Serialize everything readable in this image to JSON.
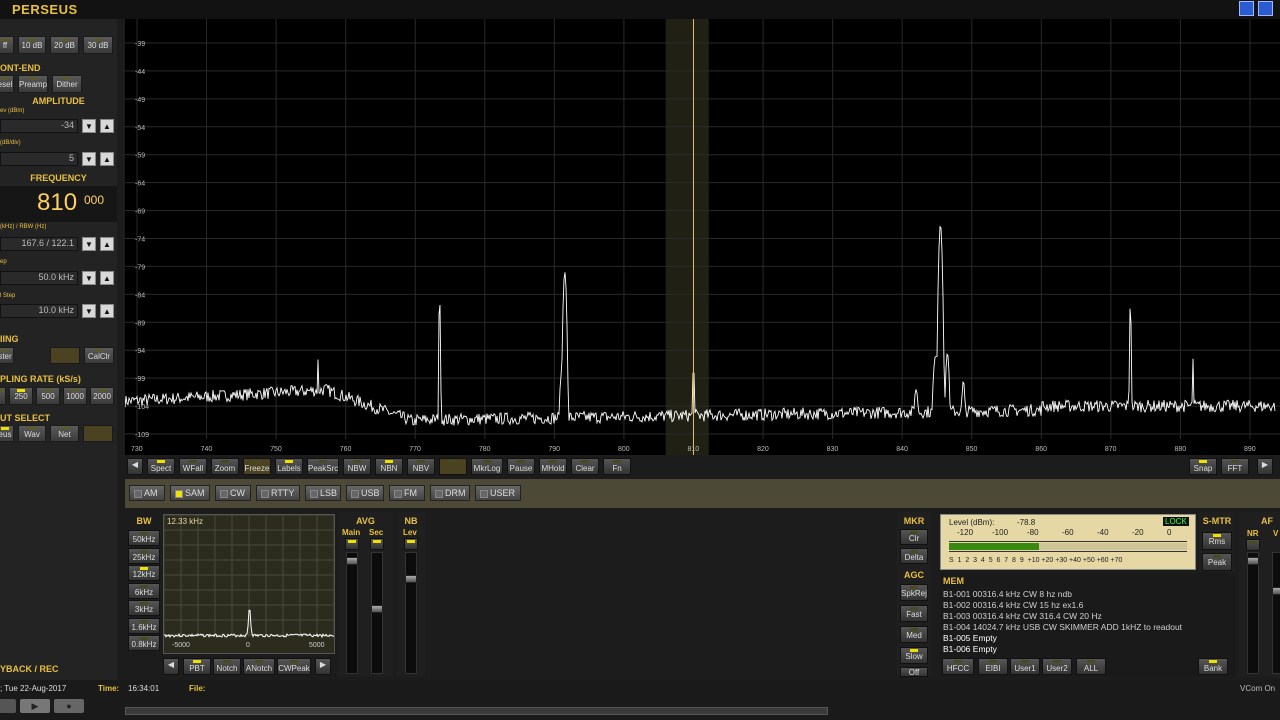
{
  "app": {
    "title": "PERSEUS"
  },
  "left": {
    "atten_buttons": [
      "ff",
      "10 dB",
      "20 dB",
      "30 dB"
    ],
    "frontend": {
      "title": "ONT-END",
      "buttons": [
        "esel",
        "Preamp",
        "Dither"
      ]
    },
    "amplitude": {
      "title": "AMPLITUDE",
      "ref_label": "ev (dBm)",
      "ref_value": "-34",
      "scale_label": "(dB/div)",
      "scale_value": "5"
    },
    "frequency": {
      "title": "FREQUENCY",
      "value_main": "810",
      "value_frac": "000",
      "span_label": "(kHz) / RBW (Hz)",
      "span_value": "167.6 / 122.1",
      "step_label": "ep",
      "step_value": "50.0 kHz",
      "fine_label": "l Step",
      "fine_value": "10.0 kHz"
    },
    "timing": {
      "title": "IING",
      "buttons": [
        "ster",
        "",
        "CalClr"
      ]
    },
    "sampling": {
      "title": "PLING RATE (kS/s)",
      "rates": [
        "",
        "250",
        "500",
        "1000",
        "2000"
      ]
    },
    "input": {
      "title": "UT SELECT",
      "buttons": [
        "eus",
        "Wav",
        "Net",
        ""
      ]
    },
    "playback": {
      "title": "YBACK / REC"
    }
  },
  "spectrum": {
    "y_ticks": [
      "-39",
      "-44",
      "-49",
      "-54",
      "-59",
      "-64",
      "-69",
      "-74",
      "-79",
      "-84",
      "-89",
      "-94",
      "-99",
      "-104",
      "-109"
    ],
    "x_ticks": [
      "730",
      "740",
      "750",
      "760",
      "770",
      "780",
      "790",
      "800",
      "810",
      "820",
      "830",
      "840",
      "850",
      "860",
      "870",
      "880",
      "890"
    ],
    "center_khz": 810,
    "colors": {
      "trace": "#ffffff",
      "grid": "#2a2a2a",
      "marker": "#e8c040",
      "passband": "#3a3a26"
    }
  },
  "toolbar": {
    "left": [
      {
        "label": "Spect",
        "on": true
      },
      {
        "label": "WFall",
        "on": false
      },
      {
        "label": "Zoom",
        "on": false
      },
      {
        "label": "Freeze",
        "on": false
      },
      {
        "label": "Labels",
        "on": true
      },
      {
        "label": "PeakSrc",
        "on": false
      },
      {
        "label": "NBW",
        "on": false
      },
      {
        "label": "NBN",
        "on": true
      },
      {
        "label": "NBV",
        "on": false
      },
      {
        "label": "",
        "on": false
      },
      {
        "label": "MkrLog",
        "on": false
      },
      {
        "label": "Pause",
        "on": false
      },
      {
        "label": "MHold",
        "on": false
      },
      {
        "label": "Clear",
        "on": false
      },
      {
        "label": "Fn",
        "on": false
      }
    ],
    "right": [
      {
        "label": "Snap",
        "on": true
      },
      {
        "label": "FFT",
        "on": false
      }
    ]
  },
  "modes": [
    {
      "label": "AM",
      "on": false
    },
    {
      "label": "SAM",
      "on": true
    },
    {
      "label": "CW",
      "on": false
    },
    {
      "label": "RTTY",
      "on": false
    },
    {
      "label": "LSB",
      "on": false
    },
    {
      "label": "USB",
      "on": false
    },
    {
      "label": "FM",
      "on": false
    },
    {
      "label": "DRM",
      "on": false
    },
    {
      "label": "USER",
      "on": false
    }
  ],
  "bw": {
    "title": "BW",
    "buttons": [
      {
        "label": "50kHz",
        "on": false
      },
      {
        "label": "25kHz",
        "on": false
      },
      {
        "label": "12kHz",
        "on": true
      },
      {
        "label": "6kHz",
        "on": false
      },
      {
        "label": "3kHz",
        "on": false
      },
      {
        "label": "1.6kHz",
        "on": false
      },
      {
        "label": "0.8kHz",
        "on": false
      }
    ],
    "display_value": "12.33 kHz",
    "axis": [
      "-5000",
      "0",
      "5000"
    ]
  },
  "filter_buttons": [
    {
      "label": "PBT",
      "on": true
    },
    {
      "label": "Notch",
      "on": false
    },
    {
      "label": "ANotch",
      "on": false
    },
    {
      "label": "CWPeak",
      "on": false
    }
  ],
  "avg": {
    "title": "AVG",
    "main": "Main",
    "sec": "Sec"
  },
  "nb": {
    "title": "NB",
    "lev": "Lev"
  },
  "mkr": {
    "title": "MKR",
    "buttons": [
      "Clr",
      "Delta"
    ]
  },
  "agc": {
    "title": "AGC",
    "buttons": [
      "SpkRej",
      "Fast",
      "Med",
      "Slow",
      "Off"
    ]
  },
  "smeter": {
    "level_label": "Level (dBm):",
    "level_value": "-78.8",
    "lock": "LOCK",
    "dbm_scale": [
      "-120",
      "-100",
      "-80",
      "-60",
      "-40",
      "-20",
      "0"
    ],
    "s_scale": "S  1  2  3  4  5  6  7  8  9  +10 +20 +30 +40 +50 +60 +70",
    "fill_fraction": 0.38
  },
  "smtr": {
    "title": "S-MTR",
    "buttons": [
      "Rms",
      "Peak"
    ]
  },
  "af": {
    "title": "AF",
    "nr": "NR",
    "v": "V"
  },
  "mem": {
    "title": "MEM",
    "lines": [
      "B1-001 00316.4 kHz  CW  8 hz ndb",
      "B1-002 00316.4 kHz  CW  15 hz ex1.6",
      "B1-003 00316.4 kHz  CW  316.4 CW 20 Hz",
      "B1-004 14024.7 kHz USB  CW SKIMMER ADD 1kHZ to readout",
      "B1-005 Empty",
      "B1-006 Empty"
    ],
    "buttons": [
      "HFCC",
      "EIBI",
      "User1",
      "User2",
      "ALL",
      "Bank"
    ]
  },
  "status": {
    "date": "; Tue 22-Aug-2017",
    "time_label": "Time:",
    "time": "16:34:01",
    "file_label": "File:",
    "right": "VCom On"
  }
}
